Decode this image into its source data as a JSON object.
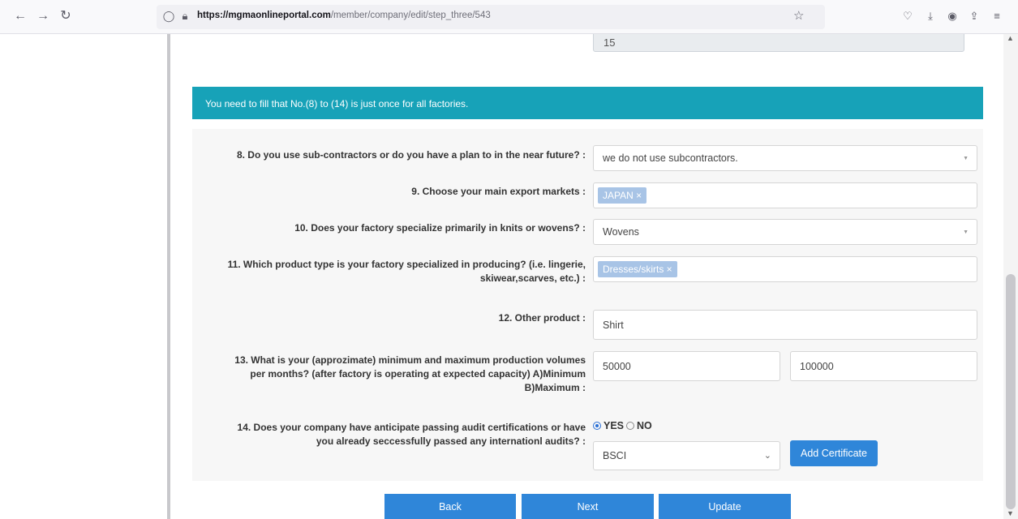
{
  "browser": {
    "url_host": "https://mgmaonlineportal.com",
    "url_path": "/member/company/edit/step_three/543"
  },
  "form": {
    "top_field_value": "15",
    "info_banner": "You need to fill that No.(8) to (14) is just once for all factories.",
    "q8": {
      "label": "8. Do you use sub-contractors or do you have a plan to in the near future? :",
      "value": "we do not use subcontractors."
    },
    "q9": {
      "label": "9. Choose your main export markets :",
      "tag": "JAPAN ×"
    },
    "q10": {
      "label": "10. Does your factory specialize primarily in knits or wovens? :",
      "value": "Wovens"
    },
    "q11": {
      "label_line1": "11. Which product type is your factory specialized in producing? (i.e. lingerie,",
      "label_line2": "skiwear,scarves, etc.) :",
      "tag": "Dresses/skirts ×"
    },
    "q12": {
      "label": "12. Other product :",
      "value": "Shirt"
    },
    "q13": {
      "label_line1": "13. What is your (approzimate) minimum and maximum production volumes",
      "label_line2": "per months? (after factory is operating at expected capacity) A)Minimum",
      "label_line3": "B)Maximum :",
      "min_value": "50000",
      "max_value": "100000"
    },
    "q14": {
      "label_line1": "14. Does your company have anticipate passing audit certifications or have",
      "label_line2": "you already seccessfully passed any internationl audits? :",
      "yes_label": "YES",
      "no_label": "NO",
      "cert_value": "BSCI",
      "add_cert_label": "Add Certificate"
    }
  },
  "footer": {
    "back_label": "Back",
    "next_label": "Next",
    "update_label": "Update"
  }
}
